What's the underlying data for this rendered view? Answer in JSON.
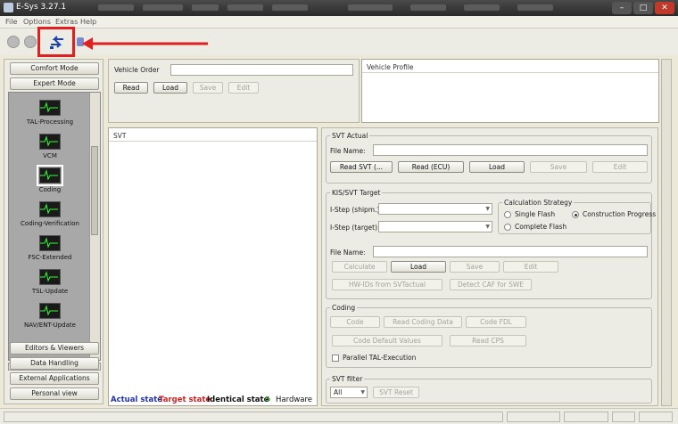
{
  "window": {
    "title": "E-Sys 3.27.1",
    "close_glyph": "✕"
  },
  "menu": [
    "File",
    "Options",
    "Extras",
    "Help"
  ],
  "toolbar": {
    "connect_icon": "connect-icon",
    "highlight_color": "#e02020"
  },
  "sidebar": {
    "comfort_mode": "Comfort Mode",
    "expert_mode": "Expert Mode",
    "tools": [
      "TAL-Processing",
      "VCM",
      "Coding",
      "Coding-Verification",
      "FSC-Extended",
      "TSL-Update",
      "NAV/ENT-Update"
    ],
    "scroll_label": "|||",
    "bottom": [
      "Editors & Viewers",
      "Data Handling",
      "External Applications",
      "Personal view"
    ]
  },
  "vehicle_order": {
    "label": "Vehicle Order",
    "value": "",
    "buttons": {
      "read": "Read",
      "load": "Load",
      "save": "Save",
      "edit": "Edit"
    }
  },
  "vehicle_profile": {
    "label": "Vehicle Profile"
  },
  "svt": {
    "label": "SVT"
  },
  "svt_actual": {
    "title": "SVT Actual",
    "file_label": "File Name:",
    "file_value": "",
    "buttons": {
      "read_svt": "Read SVT (...",
      "read_ecu": "Read (ECU)",
      "load": "Load",
      "save": "Save",
      "edit": "Edit"
    }
  },
  "kis": {
    "title": "KIS/SVT Target",
    "istep_shipm_label": "I-Step (shipm.):",
    "istep_target_label": "I-Step (target):",
    "calc_title": "Calculation Strategy",
    "calc_options": [
      "Single Flash",
      "Construction Progress",
      "Complete Flash"
    ],
    "calc_selected": "Construction Progress",
    "file_label": "File Name:",
    "buttons": {
      "calculate": "Calculate",
      "load": "Load",
      "save": "Save",
      "edit": "Edit",
      "hwids": "HW-IDs from SVTactual",
      "detect_caf": "Detect CAF for SWE"
    }
  },
  "coding": {
    "title": "Coding",
    "buttons": {
      "code": "Code",
      "read_coding": "Read Coding Data",
      "code_fdl": "Code FDL",
      "code_default": "Code Default Values",
      "read_cps": "Read CPS"
    },
    "parallel": "Parallel TAL-Execution"
  },
  "svt_filter": {
    "title": "SVT filter",
    "select_value": "All",
    "reset": "SVT Reset"
  },
  "legend": {
    "actual": {
      "text": "Actual state",
      "color": "#2233aa"
    },
    "target": {
      "text": "Target state",
      "color": "#cc2222"
    },
    "identical": {
      "text": "Identical state",
      "color": "#111111"
    },
    "hardware_glyph": "♻",
    "hardware": "Hardware"
  }
}
